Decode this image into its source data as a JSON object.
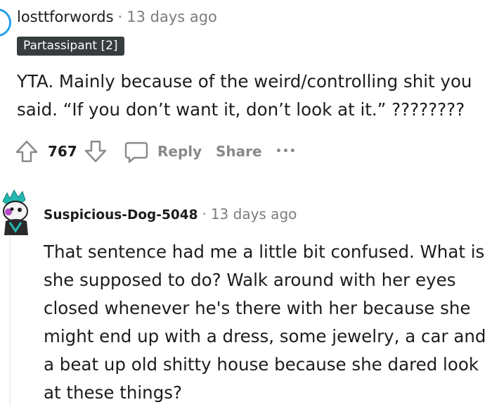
{
  "comment1": {
    "username": "losttforwords",
    "separator": "·",
    "time": "13 days ago",
    "flair": "Partassipant [2]",
    "body": "YTA. Mainly because of the weird/controlling shit you said. “If you don’t want it, don’t look at it.” ????????",
    "votes": "767",
    "reply_label": "Reply",
    "share_label": "Share",
    "more_label": "•••"
  },
  "comment2": {
    "username": "Suspicious-Dog-5048",
    "separator": "·",
    "time": "13 days ago",
    "body": "That sentence had me a little bit confused. What is she supposed to do? Walk around with her eyes closed whenever he's there with her because she might end up with a dress, some jewelry, a car and a beat up old shitty house because she dared look at these things?"
  },
  "colors": {
    "meta_gray": "#7c7c7c",
    "action_gray": "#878a8c",
    "flair_bg": "#373c3f",
    "avatar_border": "#24a0ed",
    "thread_line": "#edeff1"
  },
  "icons": [
    "upvote-icon",
    "downvote-icon",
    "comment-bubble-icon",
    "more-options-icon",
    "snoo-avatar-icon"
  ]
}
